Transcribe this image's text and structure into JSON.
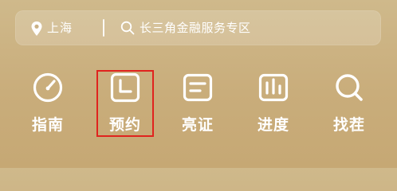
{
  "header": {
    "location": "上海",
    "search_placeholder": "长三角金融服务专区"
  },
  "nav": {
    "items": [
      {
        "label": "指南",
        "icon": "gauge-icon"
      },
      {
        "label": "预约",
        "icon": "clock-icon"
      },
      {
        "label": "亮证",
        "icon": "card-icon"
      },
      {
        "label": "进度",
        "icon": "bar-chart-icon"
      },
      {
        "label": "找茬",
        "icon": "search-icon"
      }
    ],
    "highlighted": "预约"
  },
  "colors": {
    "background": "#c9ad7b",
    "text": "#ffffff",
    "highlight": "#e0231e"
  }
}
